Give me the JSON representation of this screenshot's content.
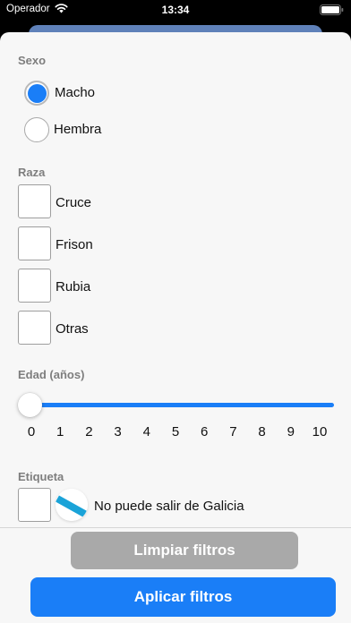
{
  "status_bar": {
    "carrier": "Operador",
    "time": "13:34"
  },
  "filters": {
    "sexo": {
      "title": "Sexo",
      "options": [
        {
          "label": "Macho",
          "selected": true
        },
        {
          "label": "Hembra",
          "selected": false
        }
      ]
    },
    "raza": {
      "title": "Raza",
      "options": [
        {
          "label": "Cruce",
          "checked": false
        },
        {
          "label": "Frison",
          "checked": false
        },
        {
          "label": "Rubia",
          "checked": false
        },
        {
          "label": "Otras",
          "checked": false
        }
      ]
    },
    "edad": {
      "title": "Edad (años)",
      "ticks": [
        "0",
        "1",
        "2",
        "3",
        "4",
        "5",
        "6",
        "7",
        "8",
        "9",
        "10"
      ],
      "value": 0,
      "min": 0,
      "max": 10
    },
    "etiqueta": {
      "title": "Etiqueta",
      "options": [
        {
          "label": "No puede salir de Galicia",
          "checked": false,
          "icon": "galicia-flag-icon"
        }
      ]
    }
  },
  "actions": {
    "clear_label": "Limpiar filtros",
    "apply_label": "Aplicar filtros"
  },
  "colors": {
    "accent": "#1a7ef7",
    "disabled_button": "#a9a9a9",
    "section_title": "#7e7e7e",
    "sheet_background": "#f7f7f7"
  }
}
